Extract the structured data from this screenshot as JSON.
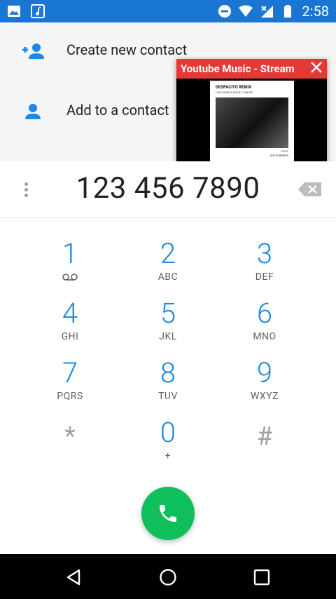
{
  "status_bar": {
    "time": "2:58",
    "icons": [
      "gallery-icon",
      "music-note-icon",
      "do-not-disturb-icon",
      "wifi-icon",
      "no-signal-icon",
      "battery-icon"
    ]
  },
  "contact_options": [
    {
      "label": "Create new contact",
      "icon": "add-person-icon"
    },
    {
      "label": "Add to a contact",
      "icon": "person-icon"
    }
  ],
  "popup": {
    "title": "Youtube Music - Stream",
    "album_title": "DESPACITO REMIX",
    "album_subtitle": "LUIS FONSI & DADDY YANKEE",
    "album_feat_line1": "FEAT.",
    "album_feat_line2": "JUSTIN BIEBER",
    "header_color": "#e53935"
  },
  "dialer": {
    "number": "123 456 7890",
    "keys": [
      {
        "digit": "1",
        "letters": ""
      },
      {
        "digit": "2",
        "letters": "ABC"
      },
      {
        "digit": "3",
        "letters": "DEF"
      },
      {
        "digit": "4",
        "letters": "GHI"
      },
      {
        "digit": "5",
        "letters": "JKL"
      },
      {
        "digit": "6",
        "letters": "MNO"
      },
      {
        "digit": "7",
        "letters": "PQRS"
      },
      {
        "digit": "8",
        "letters": "TUV"
      },
      {
        "digit": "9",
        "letters": "WXYZ"
      },
      {
        "digit": "*",
        "letters": ""
      },
      {
        "digit": "0",
        "letters": "+"
      },
      {
        "digit": "#",
        "letters": ""
      }
    ],
    "accent_color": "#1e88e5",
    "call_color": "#0fbf5c"
  },
  "nav_bar": {
    "buttons": [
      "back-icon",
      "home-icon",
      "recents-icon"
    ]
  }
}
